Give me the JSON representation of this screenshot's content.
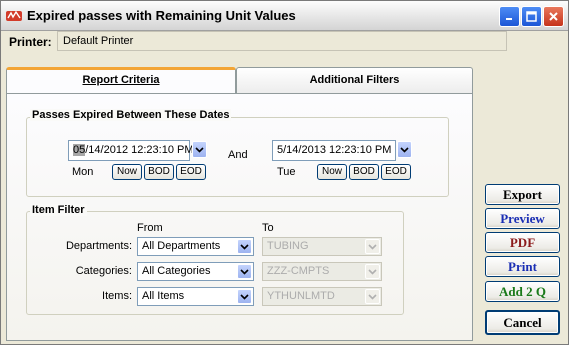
{
  "window": {
    "title": "Expired passes with Remaining Unit Values"
  },
  "printer": {
    "label": "Printer:",
    "value": "Default Printer"
  },
  "tabs": [
    {
      "label": "Report Criteria",
      "active": true
    },
    {
      "label": "Additional Filters",
      "active": false
    }
  ],
  "date_range": {
    "title": "Passes Expired Between These Dates",
    "start": {
      "month_highlight": "05",
      "rest": "/14/2012 12:23:10 PM",
      "day": "Mon"
    },
    "and_label": "And",
    "end": {
      "value": "5/14/2013 12:23:10 PM",
      "day": "Tue"
    },
    "buttons": [
      "Now",
      "BOD",
      "EOD"
    ]
  },
  "item_filter": {
    "title": "Item Filter",
    "from_label": "From",
    "to_label": "To",
    "rows": [
      {
        "label": "Departments:",
        "from": "All Departments",
        "to": "TUBING"
      },
      {
        "label": "Categories:",
        "from": "All Categories",
        "to": "ZZZ-CMPTS"
      },
      {
        "label": "Items:",
        "from": "All Items",
        "to": "YTHUNLMTD"
      }
    ]
  },
  "actions": [
    {
      "label": "Export",
      "color": "#000000"
    },
    {
      "label": "Preview",
      "color": "#1a2eb4"
    },
    {
      "label": "PDF",
      "color": "#8b1a1a"
    },
    {
      "label": "Print",
      "color": "#1a2eb4"
    },
    {
      "label": "Add 2 Q",
      "color": "#1a7a1a"
    },
    {
      "label": "Cancel",
      "color": "#000000"
    }
  ]
}
